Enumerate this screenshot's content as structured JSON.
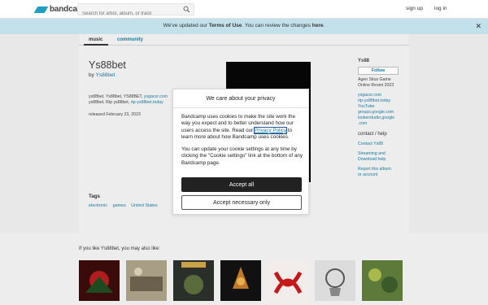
{
  "header": {
    "logo_text": "bandcamp",
    "search_placeholder": "Search for artist, album, or track",
    "signup_label": "sign up",
    "login_label": "log in"
  },
  "notice": {
    "before": "We've updated our ",
    "terms_link": "Terms of Use",
    "middle": ". You can review the changes ",
    "here_link": "here",
    "after": ".",
    "close_icon": "close-icon"
  },
  "tabs": {
    "music": "music",
    "community": "community"
  },
  "album": {
    "title": "Ys88bet",
    "by_prefix": "by ",
    "artist": "Ys88bet",
    "desc_text": "ys88bet, Ys88bet, YS88BET, ",
    "desc_link1": "ysgacor.com",
    "desc_text2": "ys88bet, Rtp ys88bet, ",
    "desc_link2": "rtp-ys88bet.today",
    "released": "released February 23, 2023",
    "tags_heading": "Tags",
    "tags": [
      "electronic",
      "games",
      "United States"
    ]
  },
  "sidebar": {
    "name": "Ys88",
    "follow": "Follow",
    "bio": [
      "Agen Situs Game",
      "Online Resmi 2023"
    ],
    "links": [
      "ysgacor.com",
      "rtp-ys88bet.today",
      "YouTube",
      "groups.google.com",
      "lookerstudio.google",
      ".com"
    ],
    "contact_heading": "contact / help",
    "contact_links": [
      "Contact Ys88",
      "Streaming and",
      "Download help",
      "Report this album",
      "or account"
    ]
  },
  "recs": {
    "title": "If you like Ys88bet, you may also like:"
  },
  "cookie": {
    "title": "We care about your privacy",
    "para1_before": "Bandcamp uses cookies to make the site work the way you expect and to better understand how our users access the site. Read our ",
    "para1_link": "Privacy Policy",
    "para1_after": " to learn more about how Bandcamp uses cookies.",
    "para2": "You can update your cookie settings at any time by clicking the \"Cookie settings\" link at the bottom of any Bandcamp page.",
    "accept_all": "Accept all",
    "accept_necessary": "Accept necessary only"
  },
  "colors": {
    "accent": "#1a7aa0",
    "notice_bg": "#c3e1ea",
    "button_dark": "#222222"
  }
}
